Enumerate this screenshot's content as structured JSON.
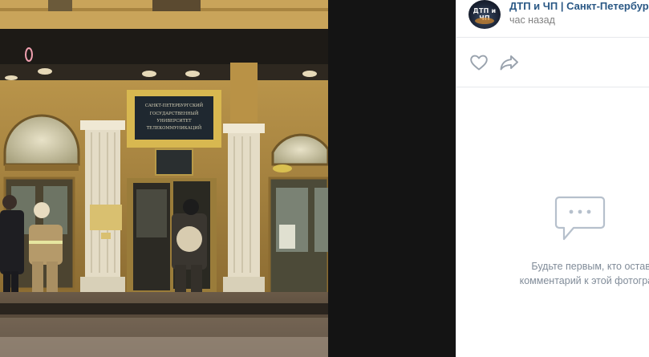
{
  "photo": {
    "alt": "",
    "signs": {
      "main_plate": [
        "САНКТ-ПЕТЕРБУРГСКИЙ",
        "ГОСУДАРСТВЕННЫЙ",
        "УНИВЕРСИТЕТ",
        "ТЕЛЕКОММУНИКАЦИЙ"
      ]
    }
  },
  "post": {
    "author_name": "ДТП и ЧП | Санкт-Петербург |",
    "avatar_text": "ДТП и ЧП",
    "time": "час назад"
  },
  "actions": {
    "like_icon": "heart-icon",
    "share_icon": "share-arrow-icon"
  },
  "comments": {
    "empty_icon": "comment-bubble-icon",
    "empty_line1": "Будьте первым, кто оставит",
    "empty_line2": "комментарий к этой фотографии"
  },
  "colors": {
    "link": "#2a5885",
    "muted": "#828282",
    "icon": "#99a2ad",
    "viewer_bg": "#141414"
  }
}
